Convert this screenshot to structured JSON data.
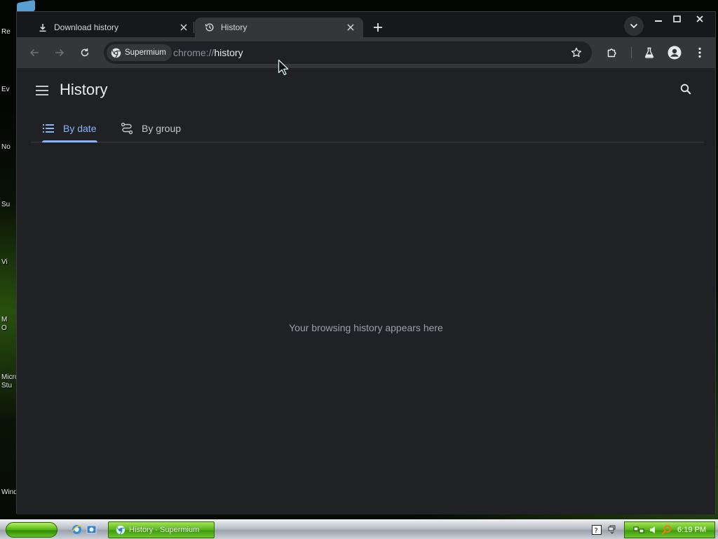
{
  "desktop": {
    "icon_labels": [
      "Re",
      "Ev",
      "No",
      "Su",
      "Vi",
      "M",
      "O",
      "Micro",
      "Stu",
      "Wind"
    ]
  },
  "browser": {
    "tabs": [
      {
        "title": "Download history",
        "icon": "download-icon",
        "active": false
      },
      {
        "title": "History",
        "icon": "history-clock-icon",
        "active": true
      }
    ],
    "toolbar": {
      "site_chip": "Supermium",
      "url_scheme": "chrome://",
      "url_host": "history"
    }
  },
  "page": {
    "title": "History",
    "tabs": [
      {
        "label": "By date",
        "icon": "list-icon",
        "selected": true
      },
      {
        "label": "By group",
        "icon": "route-icon",
        "selected": false
      }
    ],
    "empty_message": "Your browsing history appears here"
  },
  "taskbar": {
    "task_button": "History - Supermium",
    "clock": "6:19 PM"
  },
  "colors": {
    "page_bg": "#202124",
    "accent": "#8ab4f8",
    "toolbar_bg": "#35363a",
    "taskbar_green": "#55b41a"
  }
}
